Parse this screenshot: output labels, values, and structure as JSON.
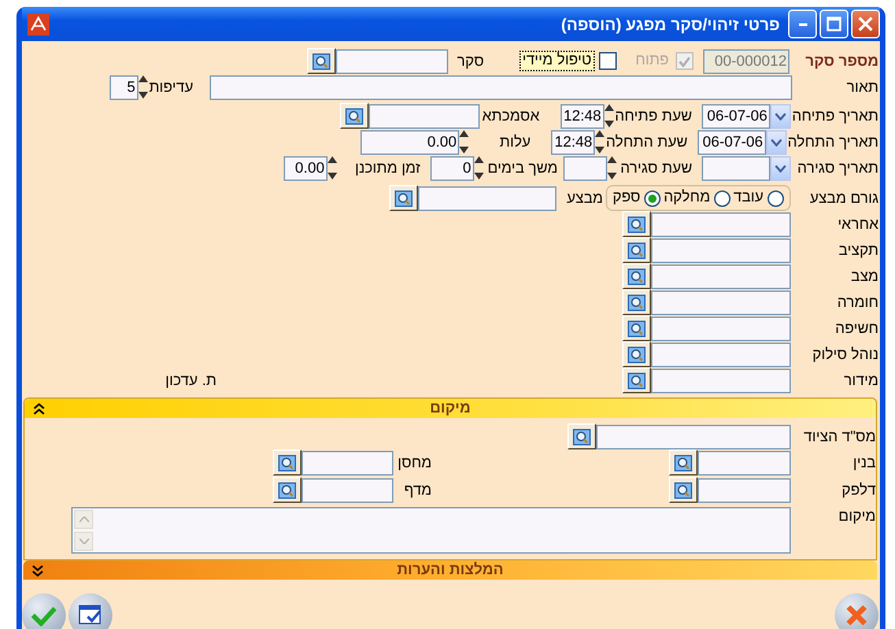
{
  "window": {
    "title": "פרטי זיהוי/סקר מפגע (הוספה)"
  },
  "survey_number": {
    "label": "מספר סקר",
    "value": "00-000012",
    "disabled": true
  },
  "open": {
    "label": "פתוח",
    "checked": true,
    "disabled": true
  },
  "urgent": {
    "label": "טיפול מיידי",
    "checked": false,
    "focused": true
  },
  "survey": {
    "label": "סקר"
  },
  "description": {
    "label": "תאור"
  },
  "priority": {
    "label": "עדיפות",
    "value": "5"
  },
  "open_date": {
    "label": "תאריך פתיחה",
    "value": "06-07-06"
  },
  "open_time": {
    "label": "שעת פתיחה",
    "value": "12:48"
  },
  "reference": {
    "label": "אסמכתא"
  },
  "start_date": {
    "label": "תאריך התחלה",
    "value": "06-07-06"
  },
  "start_time": {
    "label": "שעת התחלה",
    "value": "12:48"
  },
  "cost": {
    "label": "עלות",
    "value": "0.00"
  },
  "close_date": {
    "label": "תאריך סגירה"
  },
  "close_time": {
    "label": "שעת סגירה"
  },
  "duration_days": {
    "label": "משך בימים",
    "value": "0"
  },
  "planned_time": {
    "label": "זמן מתוכנן",
    "value": "0.00"
  },
  "performer_type": {
    "label": "גורם מבצע",
    "options": [
      {
        "label": "עובד",
        "selected": false
      },
      {
        "label": "מחלקה",
        "selected": false
      },
      {
        "label": "ספק",
        "selected": true
      }
    ]
  },
  "performer": {
    "label": "מבצע"
  },
  "lookups": [
    {
      "label": "אחראי"
    },
    {
      "label": "תקציב"
    },
    {
      "label": "מצב"
    },
    {
      "label": "חומרה"
    },
    {
      "label": "חשיפה"
    },
    {
      "label": "נוהל סילוק"
    },
    {
      "label": "מידור"
    }
  ],
  "updated_label": "ת. עדכון",
  "location": {
    "title": "מיקום",
    "expanded": true,
    "equipment": {
      "label": "מס\"ד הציוד"
    },
    "building": {
      "label": "בנין"
    },
    "warehouse": {
      "label": "מחסן"
    },
    "counter": {
      "label": "דלפק"
    },
    "shelf": {
      "label": "מדף"
    },
    "location_text": {
      "label": "מיקום"
    }
  },
  "notes": {
    "title": "המלצות והערות",
    "expanded": false
  }
}
